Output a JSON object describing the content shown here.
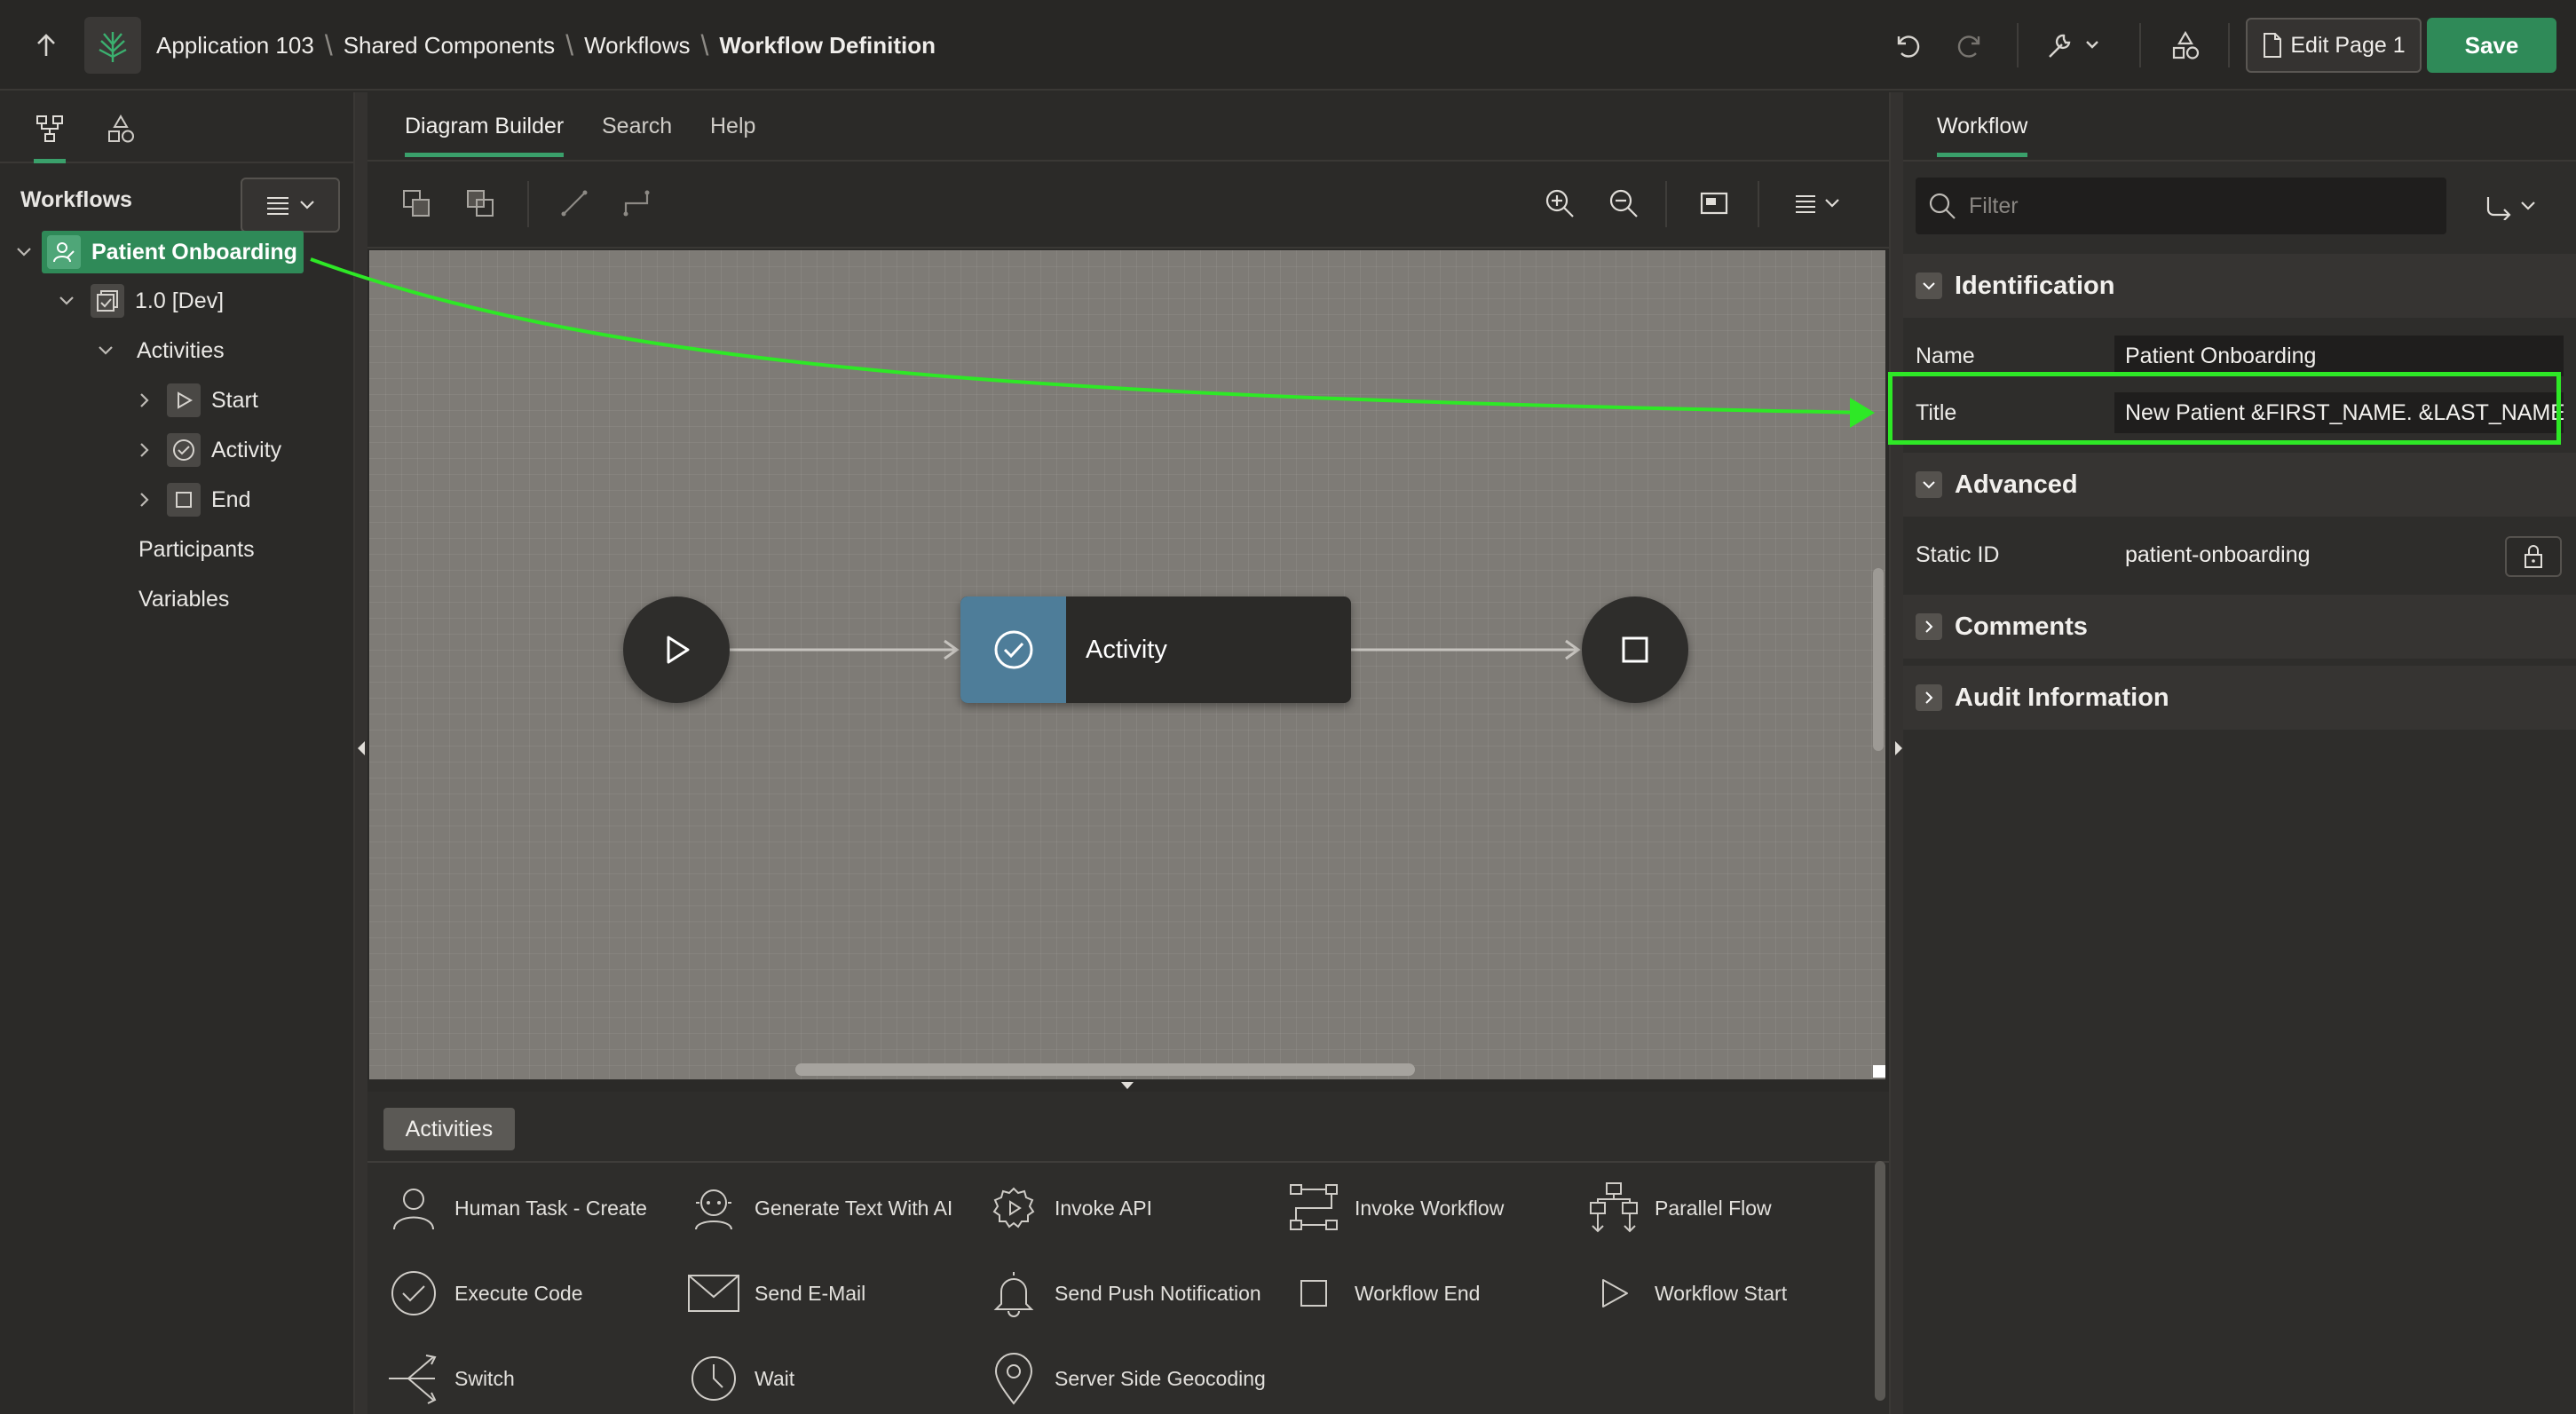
{
  "header": {
    "breadcrumb": [
      "Application 103",
      "Shared Components",
      "Workflows",
      "Workflow Definition"
    ],
    "edit_page_label": "Edit Page 1",
    "save_label": "Save"
  },
  "left_panel": {
    "heading": "Workflows",
    "tree": {
      "workflow": "Patient Onboarding",
      "version": "1.0 [Dev]",
      "activities_label": "Activities",
      "activities": [
        "Start",
        "Activity",
        "End"
      ],
      "participants_label": "Participants",
      "variables_label": "Variables"
    }
  },
  "center": {
    "tabs": [
      "Diagram Builder",
      "Search",
      "Help"
    ],
    "diagram": {
      "activity_node_label": "Activity"
    },
    "palette": {
      "tab_label": "Activities",
      "items": [
        {
          "label": "Human Task - Create",
          "icon": "person-icon"
        },
        {
          "label": "Generate Text With AI",
          "icon": "ai-robot-icon"
        },
        {
          "label": "Invoke API",
          "icon": "gear-play-icon"
        },
        {
          "label": "Invoke Workflow",
          "icon": "workflow-icon"
        },
        {
          "label": "Parallel Flow",
          "icon": "parallel-flow-icon"
        },
        {
          "label": "Execute Code",
          "icon": "check-circle-icon"
        },
        {
          "label": "Send E-Mail",
          "icon": "envelope-icon"
        },
        {
          "label": "Send Push Notification",
          "icon": "bell-icon"
        },
        {
          "label": "Workflow End",
          "icon": "square-icon"
        },
        {
          "label": "Workflow Start",
          "icon": "play-icon"
        },
        {
          "label": "Switch",
          "icon": "switch-icon"
        },
        {
          "label": "Wait",
          "icon": "clock-icon"
        },
        {
          "label": "Server Side Geocoding",
          "icon": "map-pin-icon"
        }
      ]
    }
  },
  "right_panel": {
    "tab": "Workflow",
    "filter_placeholder": "Filter",
    "sections": {
      "identification": "Identification",
      "advanced": "Advanced",
      "comments": "Comments",
      "audit": "Audit Information"
    },
    "fields": {
      "name_label": "Name",
      "name_value": "Patient Onboarding",
      "title_label": "Title",
      "title_value": "New Patient &FIRST_NAME. &LAST_NAME.",
      "static_id_label": "Static ID",
      "static_id_value": "patient-onboarding"
    }
  },
  "colors": {
    "accent_green": "#2f8a58",
    "annotation_green": "#2ee826",
    "activity_blue": "#4e7d99",
    "canvas_bg": "#7e7b76"
  }
}
